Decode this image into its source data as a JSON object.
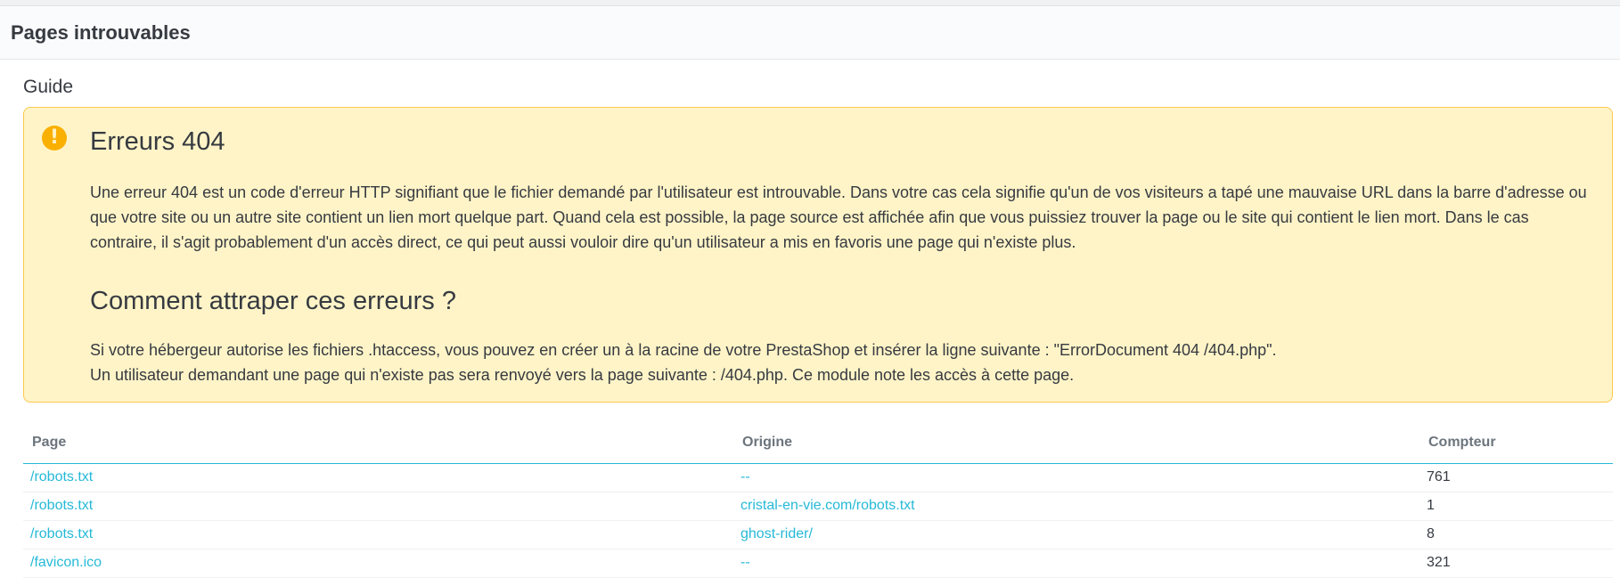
{
  "panel": {
    "title": "Pages introuvables"
  },
  "guide": {
    "label": "Guide",
    "heading1": "Erreurs 404",
    "paragraph1": "Une erreur 404 est un code d'erreur HTTP signifiant que le fichier demandé par l'utilisateur est introuvable. Dans votre cas cela signifie qu'un de vos visiteurs a tapé une mauvaise URL dans la barre d'adresse ou que votre site ou un autre site contient un lien mort quelque part. Quand cela est possible, la page source est affichée afin que vous puissiez trouver la page ou le site qui contient le lien mort. Dans le cas contraire, il s'agit probablement d'un accès direct, ce qui peut aussi vouloir dire qu'un utilisateur a mis en favoris une page qui n'existe plus.",
    "heading2": "Comment attraper ces erreurs ?",
    "paragraph2_line1": "Si votre hébergeur autorise les fichiers .htaccess, vous pouvez en créer un à la racine de votre PrestaShop et insérer la ligne suivante : \"ErrorDocument 404 /404.php\".",
    "paragraph2_line2": "Un utilisateur demandant une page qui n'existe pas sera renvoyé vers la page suivante : /404.php. Ce module note les accès à cette page.",
    "icon": "exclamation-circle-icon",
    "icon_color": "#fab000"
  },
  "table": {
    "headers": {
      "page": "Page",
      "origin": "Origine",
      "counter": "Compteur"
    },
    "rows": [
      {
        "page": "/robots.txt",
        "origin": "--",
        "counter": "761"
      },
      {
        "page": "/robots.txt",
        "origin": "cristal-en-vie.com/robots.txt",
        "counter": "1"
      },
      {
        "page": "/robots.txt",
        "origin": "ghost-rider/",
        "counter": "8"
      },
      {
        "page": "/favicon.ico",
        "origin": "--",
        "counter": "321"
      }
    ]
  },
  "colors": {
    "link": "#25b9d7",
    "alert_bg": "#fff4c7",
    "alert_border": "#fcc94f"
  }
}
